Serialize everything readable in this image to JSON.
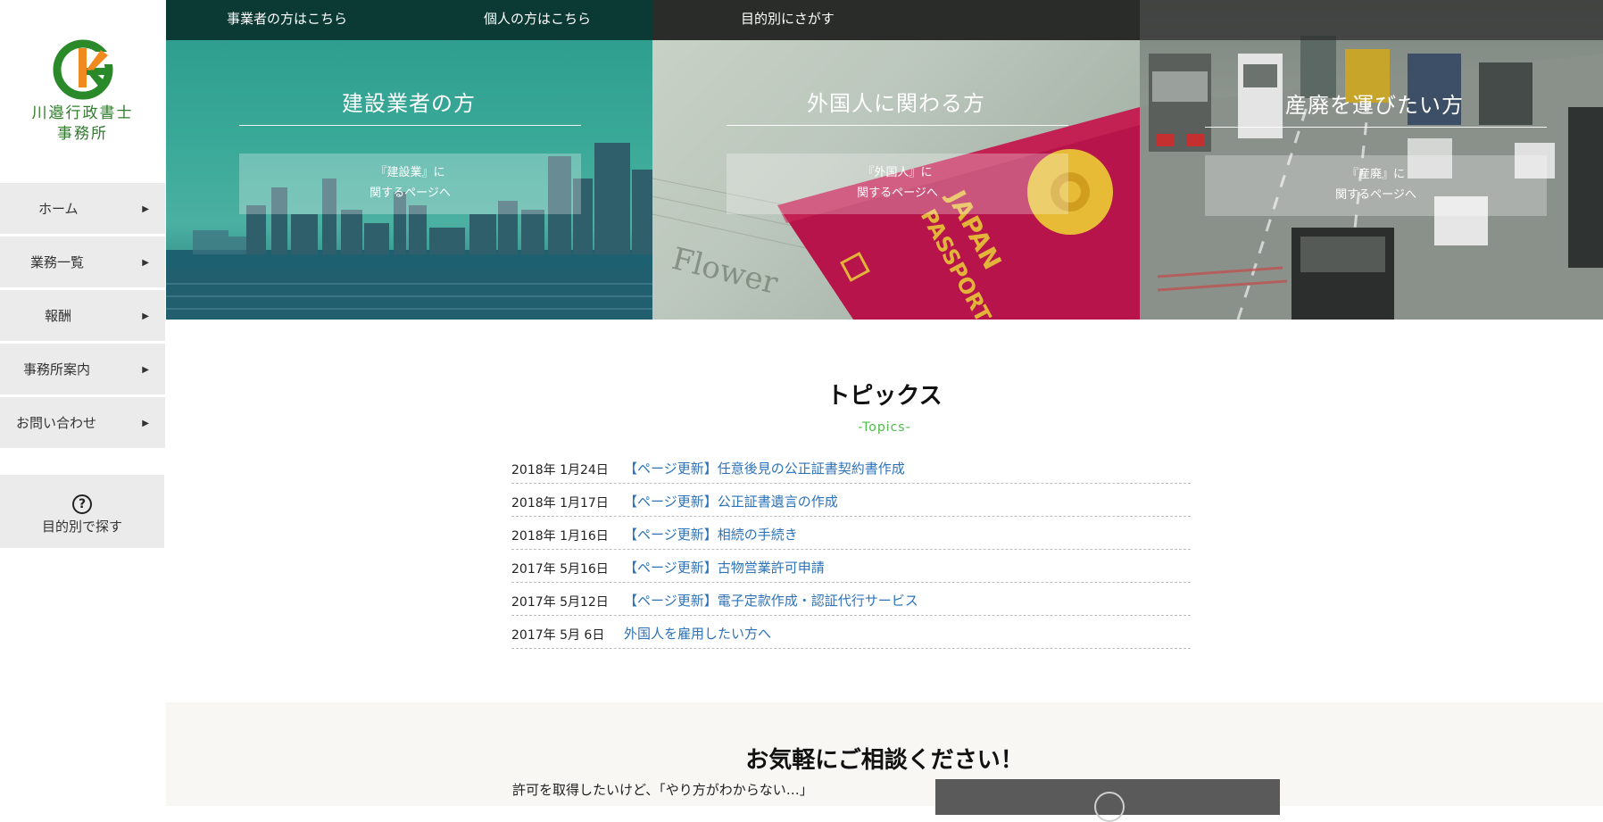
{
  "logo": {
    "name_line1": "川邉行政書士",
    "name_line2": "事務所",
    "colors": {
      "green": "#2a8a2a",
      "orange": "#f08a1e"
    }
  },
  "sidebar": {
    "items": [
      {
        "label": "ホーム",
        "arrow": "▶"
      },
      {
        "label": "業務一覧",
        "arrow": "▶"
      },
      {
        "label": "報酬",
        "arrow": "▶"
      },
      {
        "label": "事務所案内",
        "arrow": "▶"
      },
      {
        "label": "お問い合わせ",
        "arrow": "▶"
      }
    ],
    "purpose": {
      "icon": "question-circle-icon",
      "icon_glyph": "?",
      "label": "目的別で探す"
    }
  },
  "topnav": {
    "business": "事業者の方はこちら",
    "individual": "個人の方はこちら",
    "purpose": "目的別にさがす"
  },
  "panels": [
    {
      "title": "建設業者の方",
      "btn_line1": "『建設業』に",
      "btn_line2": "関するページへ"
    },
    {
      "title": "外国人に関わる方",
      "btn_line1": "『外国人』に",
      "btn_line2": "関するページへ"
    },
    {
      "title": "産廃を運びたい方",
      "btn_line1": "『産廃』に",
      "btn_line2": "関するページへ"
    }
  ],
  "topics": {
    "title": "トピックス",
    "subtitle": "-Topics-",
    "items": [
      {
        "date": "2018年 1月24日",
        "text": "【ページ更新】任意後見の公正証書契約書作成"
      },
      {
        "date": "2018年 1月17日",
        "text": "【ページ更新】公正証書遺言の作成"
      },
      {
        "date": "2018年 1月16日",
        "text": "【ページ更新】相続の手続き"
      },
      {
        "date": "2017年 5月16日",
        "text": "【ページ更新】古物営業許可申請"
      },
      {
        "date": "2017年 5月12日",
        "text": "【ページ更新】電子定款作成・認証代行サービス"
      },
      {
        "date": "2017年 5月 6日",
        "text": "外国人を雇用したい方へ"
      }
    ],
    "link_color": "#2e73b8",
    "accent_color": "#4cbb47"
  },
  "consult": {
    "title": "お気軽にご相談ください！",
    "text": "許可を取得したいけど、「やり方がわからない…」"
  }
}
